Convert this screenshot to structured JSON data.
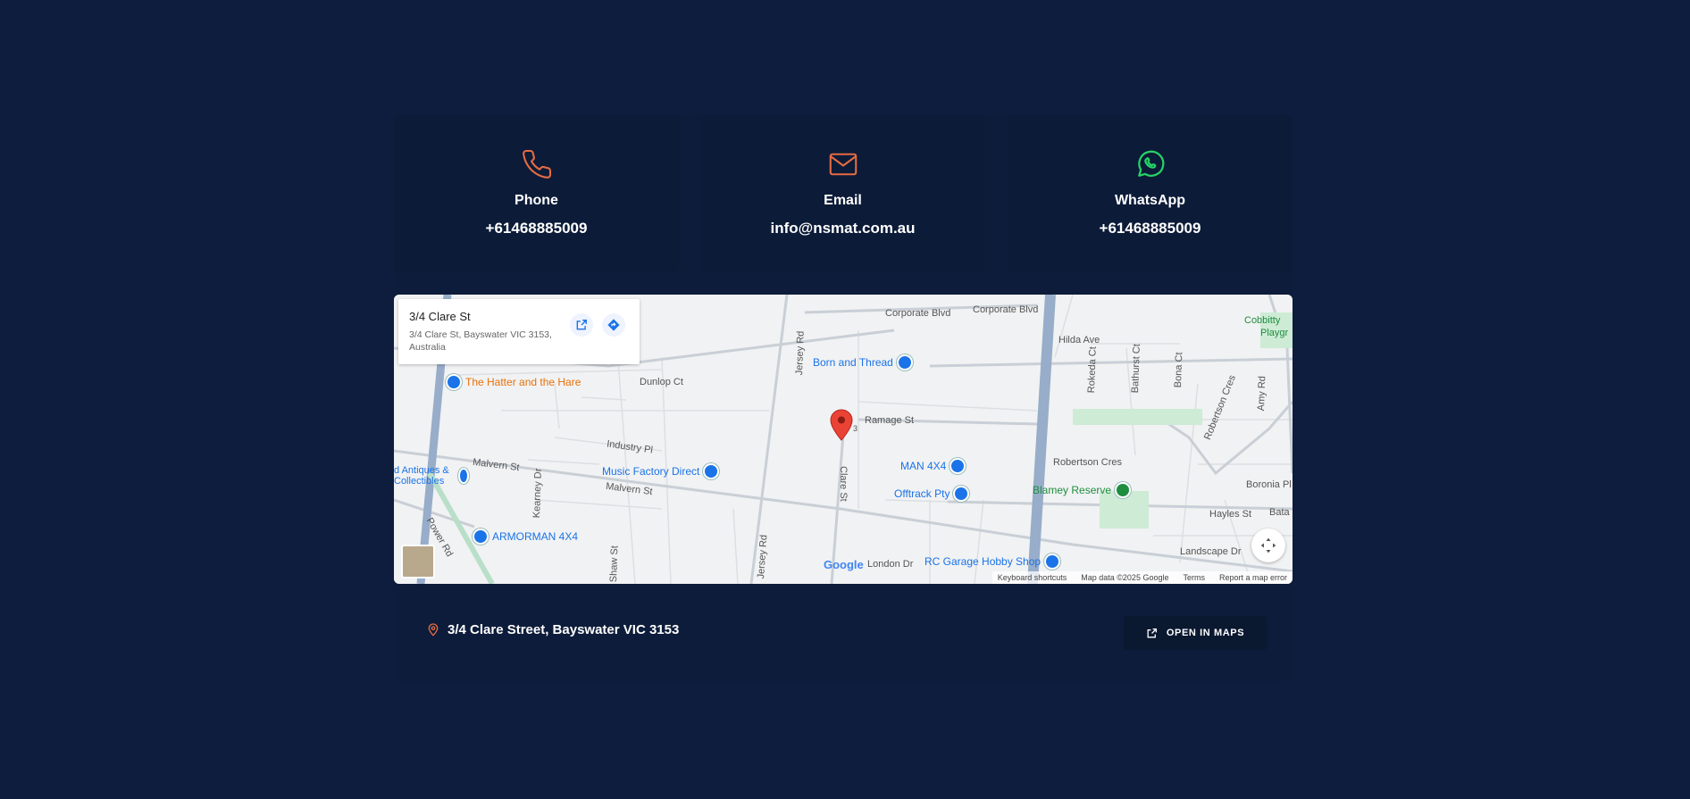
{
  "contact": {
    "phone": {
      "label": "Phone",
      "value": "+61468885009",
      "icon": "phone-icon",
      "color": "#e56b43"
    },
    "email": {
      "label": "Email",
      "value": "info@nsmat.com.au",
      "icon": "mail-icon",
      "color": "#e56b43"
    },
    "whatsapp": {
      "label": "WhatsApp",
      "value": "+61468885009",
      "icon": "whatsapp-icon",
      "color": "#25d366"
    }
  },
  "map": {
    "infocard": {
      "title": "3/4 Clare St",
      "address": "3/4 Clare St, Bayswater VIC 3153, Australia"
    },
    "streets": {
      "corporate1": "Corporate Blvd",
      "corporate2": "Corporate Blvd",
      "hilda": "Hilda Ave",
      "dunlop": "Dunlop Ct",
      "jersey1": "Jersey Rd",
      "jersey2": "Jersey Rd",
      "ramage": "Ramage St",
      "industry": "Industry Pl",
      "malvern1": "Malvern St",
      "malvern2": "Malvern St",
      "clare": "Clare St",
      "robertson": "Robertson Cres",
      "robertson2": "Robertson Cres",
      "kearney": "Kearney Dr",
      "power": "Power Rd",
      "london": "London Dr",
      "hayles": "Hayles St",
      "landscape": "Landscape Dr",
      "amy": "Amy Rd",
      "rokeda": "Rokeda Ct",
      "bathurst": "Bathurst Ct",
      "bona": "Bona Ct",
      "boronia": "Boronia Pl",
      "bata": "Bata",
      "cobbitty": "Cobbitty",
      "playg": "Playgr",
      "shaw": "Shaw St",
      "marker_num": "3"
    },
    "pois": {
      "born": "Born and Thread",
      "hatter": "The Hatter and the Hare",
      "music": "Music Factory Direct",
      "man4x4": "MAN 4X4",
      "offtrack": "Offtrack Pty",
      "blamey": "Blamey Reserve",
      "armorman": "ARMORMAN 4X4",
      "rcgarage": "RC Garage Hobby Shop",
      "antiques": "d Antiques & Collectibles"
    },
    "google": "Google",
    "attribution": [
      "Keyboard shortcuts",
      "Map data ©2025 Google",
      "Terms",
      "Report a map error"
    ]
  },
  "footer": {
    "address": "3/4 Clare Street, Bayswater VIC 3153",
    "open_in_maps": "OPEN IN MAPS"
  },
  "colors": {
    "background": "#0e1d3d",
    "card": "#0c1b38",
    "accent": "#e56b43"
  }
}
